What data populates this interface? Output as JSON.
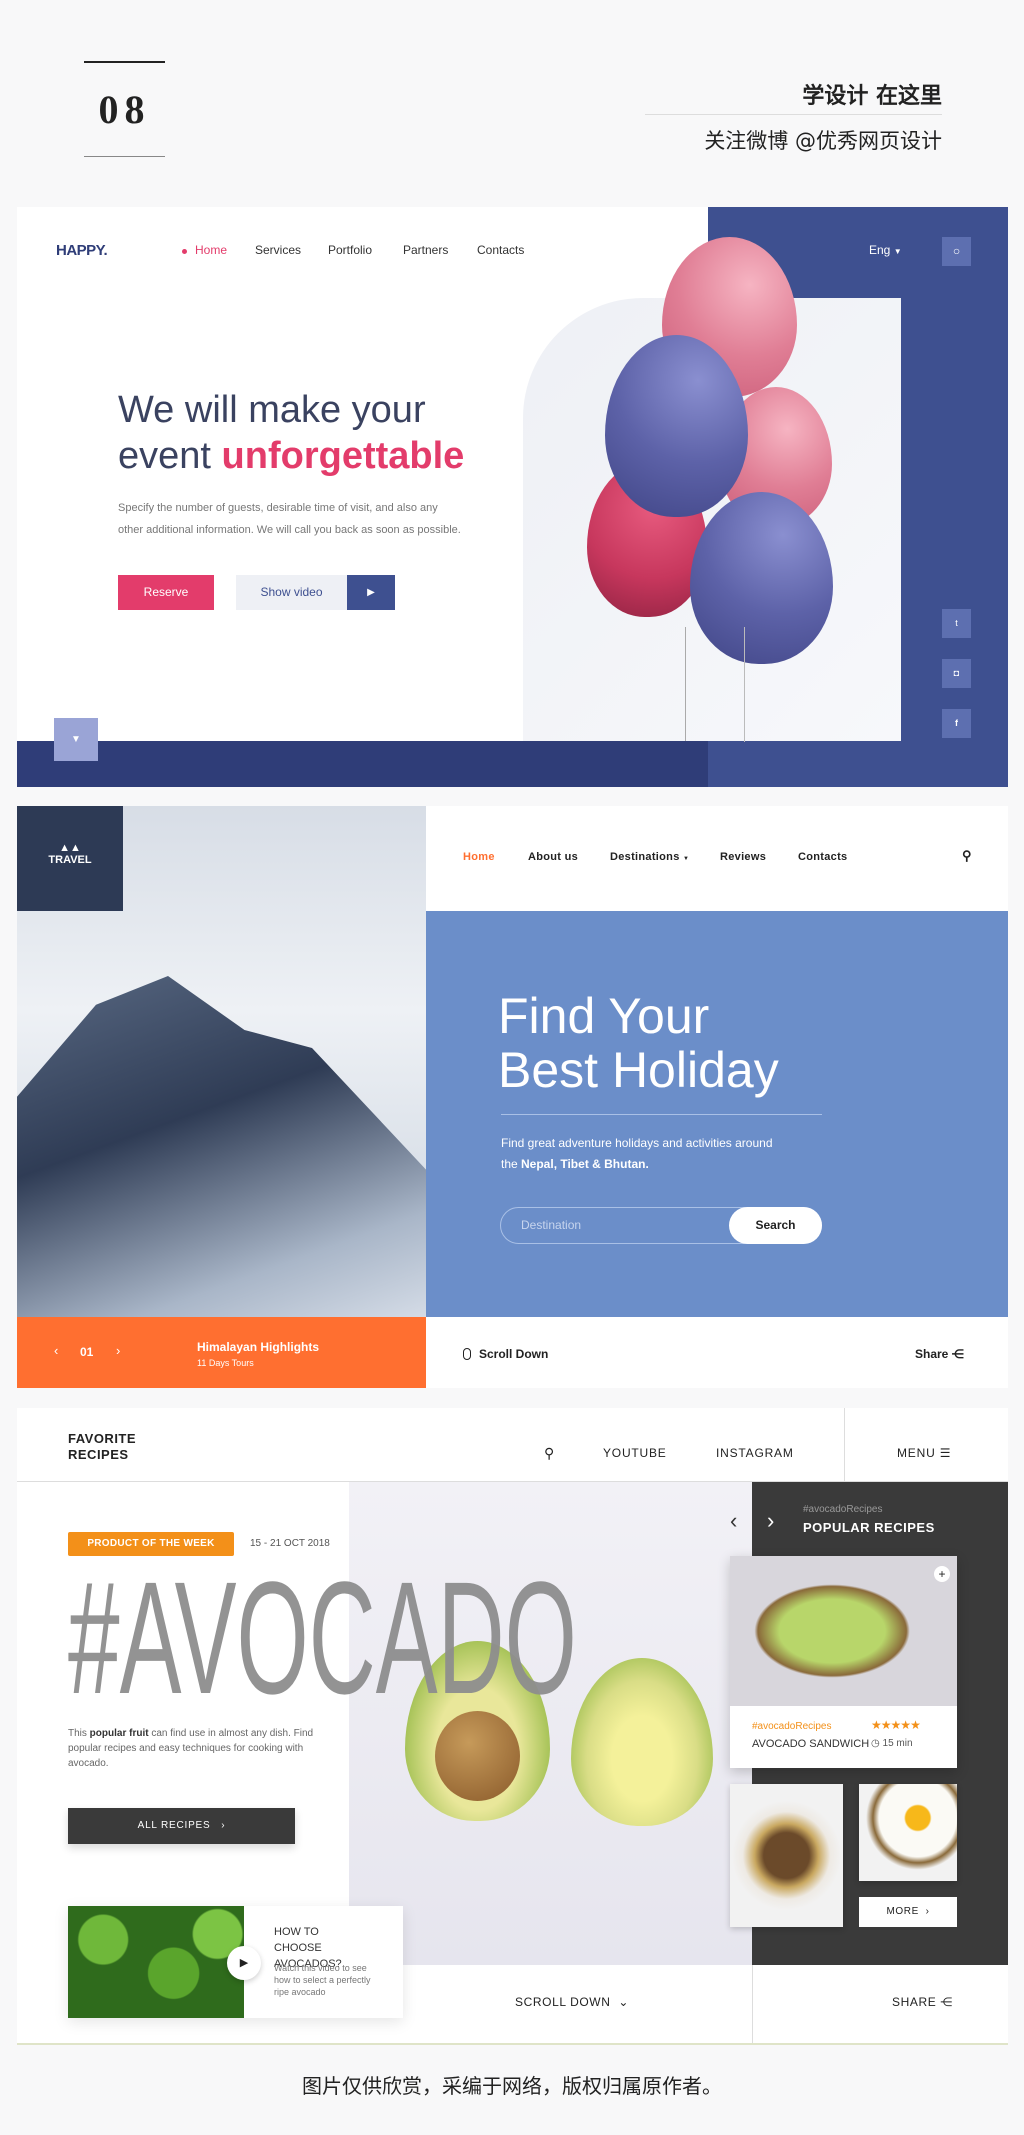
{
  "header": {
    "number": "08",
    "slogan": "学设计 在这里",
    "follow": "关注微博 @优秀网页设计"
  },
  "happy": {
    "logo": "HAPPY.",
    "nav": [
      "Home",
      "Services",
      "Portfolio",
      "Partners",
      "Contacts"
    ],
    "language": "Eng",
    "title_line1": "We will make your",
    "title_plain": "event ",
    "title_highlight": "unforgettable",
    "description_line1": "Specify the number of guests, desirable time of visit, and also any",
    "description_line2": "other additional information. We will call you back as soon as possible.",
    "reserve_label": "Reserve",
    "show_video_label": "Show video",
    "colors": {
      "accent": "#e33c6b",
      "navy": "#3e5090",
      "dark_navy": "#2f3d78"
    }
  },
  "travel": {
    "logo": "TRAVEL",
    "nav": [
      "Home",
      "About us",
      "Destinations",
      "Reviews",
      "Contacts"
    ],
    "title_line1": "Find Your",
    "title_line2": "Best Holiday",
    "description_line1": "Find great adventure holidays and activities around",
    "description_prefix": "the ",
    "description_bold": "Nepal, Tibet & Bhutan.",
    "search_placeholder": "Destination",
    "search_label": "Search",
    "slide_number": "01",
    "slide_title": "Himalayan Highlights",
    "slide_subtitle": "11 Days Tours",
    "scroll_label": "Scroll Down",
    "share_label": "Share",
    "colors": {
      "accent": "#ff6f30",
      "panel": "#6b8ec9",
      "logo_bg": "#2d3a55"
    }
  },
  "recipes": {
    "logo_line1": "FAVORITE",
    "logo_line2": "RECIPES",
    "nav": [
      "YOUTUBE",
      "INSTAGRAM"
    ],
    "menu_label": "MENU",
    "badge": "PRODUCT OF THE WEEK",
    "date_range": "15 - 21 OCT 2018",
    "hero_title": "#AVOCADO",
    "description_prefix": "This ",
    "description_bold": "popular fruit",
    "description_rest": " can find use in almost any dish. Find popular recipes and easy techniques for cooking with avocado.",
    "all_recipes_label": "ALL RECIPES",
    "video_title": "HOW TO CHOOSE AVOCADOS?",
    "video_text": "Watch this video to see how to select a perfectly ripe avocado",
    "scroll_label": "SCROLL DOWN",
    "share_label": "SHARE",
    "panel_tag": "#avocadoRecipes",
    "panel_title": "POPULAR RECIPES",
    "card_tag": "#avocadoRecipes",
    "card_title": "AVOCADO SANDWICH",
    "card_rating": 5,
    "card_time": "15 min",
    "more_label": "MORE",
    "colors": {
      "accent": "#f39019",
      "dark": "#3a3a3a",
      "hero_text": "#8e8e8e"
    }
  },
  "footer": {
    "note": "图片仅供欣赏，采编于网络，版权归属原作者。"
  }
}
